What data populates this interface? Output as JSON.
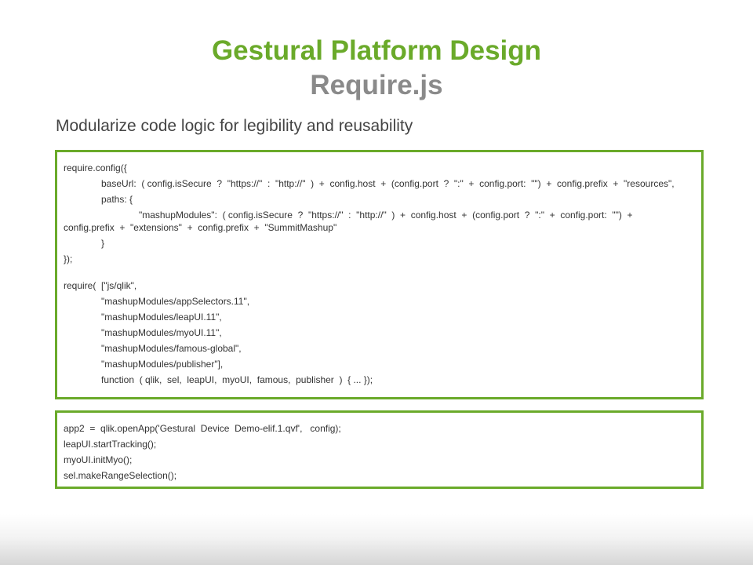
{
  "slide": {
    "title": "Gestural Platform Design",
    "subtitle": "Require.js",
    "lead": "Modularize code logic for legibility and reusability"
  },
  "config_block": {
    "lines": [
      "require.config({",
      "baseUrl:  ( config.isSecure  ?  \"https://\"  :  \"http://\"  )  +  config.host  +  (config.port  ?  \":\"  +  config.port:  \"\")  +  config.prefix  +  \"resources\",",
      "paths: {",
      "\"mashupModules\":  ( config.isSecure  ?  \"https://\"  :  \"http://\"  )  +  config.host  +  (config.port  ?  \":\"  +  config.port:  \"\")  +",
      "config.prefix  +  \"extensions\"  +  config.prefix  +  \"SummitMashup\"",
      "}",
      "});",
      "require(  [\"js/qlik\",",
      "\"mashupModules/appSelectors.11\",",
      "\"mashupModules/leapUI.11\",",
      "\"mashupModules/myoUI.11\",",
      "\"mashupModules/famous-global\",",
      "\"mashupModules/publisher\"],",
      "function  ( qlik,  sel,  leapUI,  myoUI,  famous,  publisher  )  { ... });"
    ]
  },
  "app_block": {
    "lines": [
      "app2  =  qlik.openApp('Gestural  Device  Demo-elif.1.qvf',   config);",
      "leapUI.startTracking();",
      "myoUI.initMyo();",
      "sel.makeRangeSelection();"
    ]
  },
  "colors": {
    "accent": "#6aaa2a",
    "subtitle": "#8a8a8a",
    "text": "#333333"
  }
}
